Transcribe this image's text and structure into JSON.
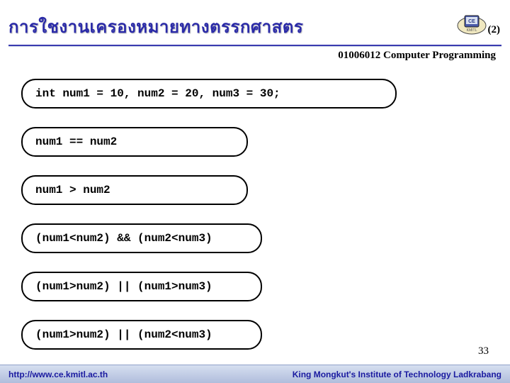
{
  "header": {
    "title_thai": "การใชงานเครองหมายทางตรรกศาสตร",
    "page_marker_top": "(2)",
    "subtitle": "01006012 Computer Programming"
  },
  "code_lines": {
    "declaration": "int num1 = 10, num2 = 20, num3 = 30;",
    "expr1": "num1 == num2",
    "expr2": "num1 > num2",
    "expr3": "(num1<num2) && (num2<num3)",
    "expr4": "(num1>num2) || (num1>num3)",
    "expr5": "(num1>num2) || (num2<num3)"
  },
  "page_number": "33",
  "footer": {
    "left": "http://www.ce.kmitl.ac.th",
    "right": "King Mongkut's Institute of Technology Ladkrabang"
  }
}
